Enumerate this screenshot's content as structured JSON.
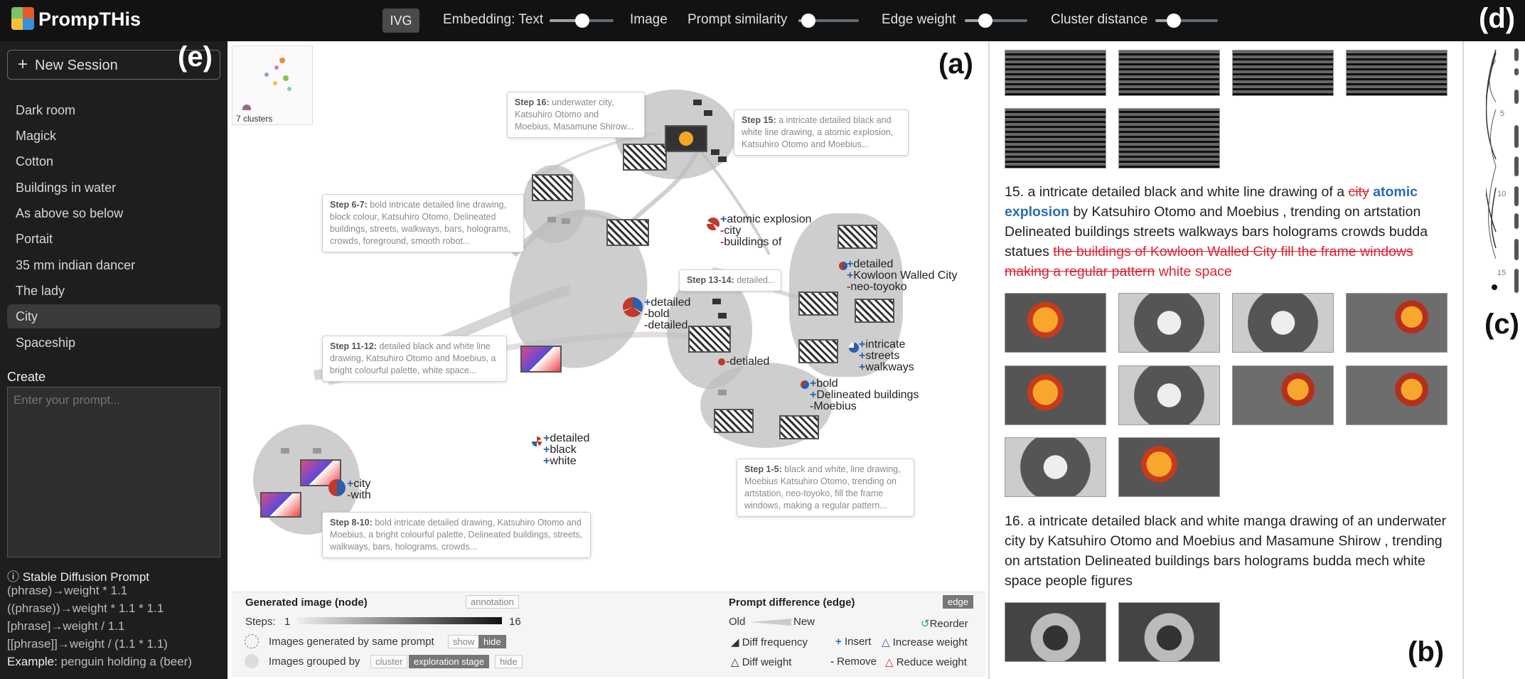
{
  "topbar": {
    "app_name": "PrompTHis",
    "ivg_button": "IVG",
    "embedding_label": "Embedding: Text",
    "image_label": "Image",
    "prompt_similarity_label": "Prompt similarity",
    "edge_weight_label": "Edge weight",
    "cluster_distance_label": "Cluster distance",
    "sliders": {
      "embedding": 0.5,
      "prompt_similarity": 0.15,
      "edge_weight": 0.35,
      "cluster_distance": 0.3
    }
  },
  "panel_labels": {
    "a": "(a)",
    "b": "(b)",
    "c": "(c)",
    "d": "(d)",
    "e": "(e)"
  },
  "sidebar": {
    "new_session": "New Session",
    "sessions": [
      "Dark room",
      "Magick",
      "Cotton",
      "Buildings in water",
      "As above so below",
      "Portait",
      "35 mm indian dancer",
      "The lady",
      "City",
      "Spaceship"
    ],
    "active_session": "City",
    "create_label": "Create",
    "prompt_placeholder": "Enter your prompt...",
    "help_title": "Stable Diffusion Prompt",
    "help_lines": [
      "(phrase)→weight * 1.1",
      "((phrase))→weight * 1.1 * 1.1",
      "[phrase]→weight / 1.1",
      "[[phrase]]→weight / (1.1 * 1.1)"
    ],
    "example_label": "Example:",
    "example_text": "penguin holding a (beer)"
  },
  "graph": {
    "minimap_label": "7 clusters",
    "steps": {
      "s16_title": "Step 16:",
      "s16_text": "underwater city, Katsuhiro Otomo and Moebius, Masamune Shirow...",
      "s15_title": "Step 15:",
      "s15_text": "a intricate detailed black and white line drawing, a atomic explosion, Katsuhiro Otomo and Moebius...",
      "s67_title": "Step 6-7:",
      "s67_text": "bold intricate detailed line drawing, block colour, Katsuhiro Otomo, Delineated buildings, streets, walkways, bars, holograms, crowds, foreground, smooth robot...",
      "s1314_title": "Step 13-14:",
      "s1314_text": "detailed...",
      "s1112_title": "Step 11-12:",
      "s1112_text": "detailed black and white line drawing, Katsuhiro Otomo and Moebius, a bright colourful palette, white space...",
      "s15b_title": "Step 1-5:",
      "s15b_text": "black and white, line drawing, Moebius Katsuhiro Otomo, trending on artstation, neo-toyoko, fill the frame windows, making a regular pattern...",
      "s810_title": "Step 8-10:",
      "s810_text": "bold intricate detailed drawing, Katsuhiro Otomo and Moebius, a bright colourful palette, Delineated buildings, streets, walkways, bars, holograms, crowds..."
    },
    "edges": {
      "e1": [
        "atomic explosion",
        "city",
        "buildings of"
      ],
      "e2": [
        "detailed",
        "bold",
        "detailed"
      ],
      "e3": [
        "detailed",
        "Kowloon Walled City",
        "neo-toyoko"
      ],
      "e4": [
        "detialed"
      ],
      "e5": [
        "intricate",
        "streets",
        "walkways"
      ],
      "e6": [
        "bold",
        "Delineated buildings",
        "Moebius"
      ],
      "e7": [
        "detailed",
        "black",
        "white"
      ],
      "e8": [
        "city",
        "with"
      ]
    }
  },
  "legend": {
    "node_title": "Generated image (node)",
    "node_tag": "annotation",
    "steps_label": "Steps:",
    "steps_min": "1",
    "steps_max": "16",
    "same_prompt": "Images generated by same prompt",
    "show": "show",
    "hide": "hide",
    "grouped_by": "Images grouped by",
    "cluster": "cluster",
    "exploration_stage": "exploration stage",
    "hide2": "hide",
    "edge_title": "Prompt difference (edge)",
    "edge_tag": "edge",
    "old": "Old",
    "new": "New",
    "reorder": "Reorder",
    "diff_frequency": "Diff frequency",
    "insert": "Insert",
    "increase_weight": "Increase weight",
    "diff_weight": "Diff weight",
    "remove": "Remove",
    "reduce_weight": "Reduce weight"
  },
  "prompts": {
    "p15_prefix": "15. a intricate detailed black and white line drawing of a",
    "p15_removed1": "city",
    "p15_inserted1": "atomic explosion",
    "p15_mid": "by Katsuhiro Otomo and Moebius , trending on artstation Delineated buildings streets walkways bars holograms crowds budda statues",
    "p15_removed2": "the buildings of Kowloon Walled City fill the frame windows making a regular pattern",
    "p15_inserted2": "white space",
    "p16": "16. a intricate detailed black and white manga drawing of an underwater city by Katsuhiro Otomo and Moebius and Masamune Shirow , trending on artstation Delineated buildings bars holograms budda mech white space people figures"
  },
  "timeline": {
    "tick_5": "5",
    "tick_10": "10",
    "tick_15": "15"
  }
}
